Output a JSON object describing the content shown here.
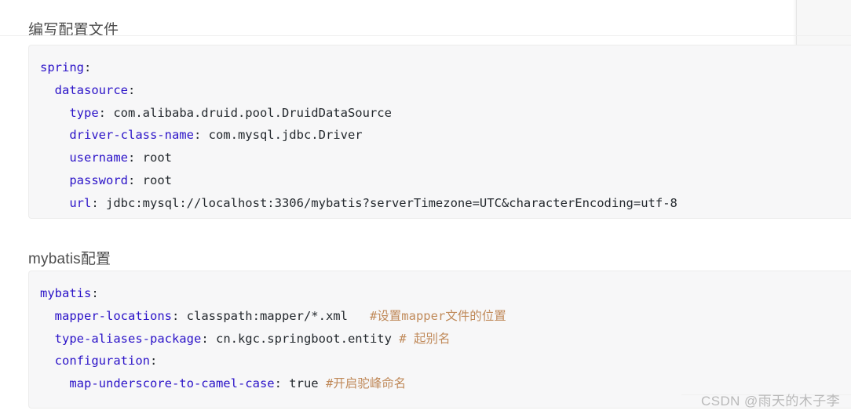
{
  "document": {
    "sections": [
      {
        "heading": "编写配置文件",
        "code_lines": [
          [
            {
              "t": "key",
              "s": "spring"
            },
            {
              "t": "punct",
              "s": ":"
            }
          ],
          [
            {
              "t": "punct",
              "s": "  "
            },
            {
              "t": "key",
              "s": "datasource"
            },
            {
              "t": "punct",
              "s": ":"
            }
          ],
          [
            {
              "t": "punct",
              "s": "    "
            },
            {
              "t": "key",
              "s": "type"
            },
            {
              "t": "punct",
              "s": ": "
            },
            {
              "t": "val",
              "s": "com.alibaba.druid.pool.DruidDataSource"
            }
          ],
          [
            {
              "t": "punct",
              "s": "    "
            },
            {
              "t": "key",
              "s": "driver-class-name"
            },
            {
              "t": "punct",
              "s": ": "
            },
            {
              "t": "val",
              "s": "com.mysql.jdbc.Driver"
            }
          ],
          [
            {
              "t": "punct",
              "s": "    "
            },
            {
              "t": "key",
              "s": "username"
            },
            {
              "t": "punct",
              "s": ": "
            },
            {
              "t": "val",
              "s": "root"
            }
          ],
          [
            {
              "t": "punct",
              "s": "    "
            },
            {
              "t": "key",
              "s": "password"
            },
            {
              "t": "punct",
              "s": ": "
            },
            {
              "t": "val",
              "s": "root"
            }
          ],
          [
            {
              "t": "punct",
              "s": "    "
            },
            {
              "t": "key",
              "s": "url"
            },
            {
              "t": "punct",
              "s": ": "
            },
            {
              "t": "val",
              "s": "jdbc:mysql://localhost:3306/mybatis?serverTimezone=UTC&characterEncoding=utf-8"
            }
          ]
        ]
      },
      {
        "heading": "mybatis配置",
        "code_lines": [
          [
            {
              "t": "key",
              "s": "mybatis"
            },
            {
              "t": "punct",
              "s": ":"
            }
          ],
          [
            {
              "t": "punct",
              "s": "  "
            },
            {
              "t": "key",
              "s": "mapper-locations"
            },
            {
              "t": "punct",
              "s": ": "
            },
            {
              "t": "val",
              "s": "classpath:mapper/*.xml"
            },
            {
              "t": "punct",
              "s": "   "
            },
            {
              "t": "comment",
              "s": "#设置mapper文件的位置"
            }
          ],
          [
            {
              "t": "punct",
              "s": "  "
            },
            {
              "t": "key",
              "s": "type-aliases-package"
            },
            {
              "t": "punct",
              "s": ": "
            },
            {
              "t": "val",
              "s": "cn.kgc.springboot.entity"
            },
            {
              "t": "punct",
              "s": " "
            },
            {
              "t": "comment",
              "s": "# 起别名"
            }
          ],
          [
            {
              "t": "punct",
              "s": "  "
            },
            {
              "t": "key",
              "s": "configuration"
            },
            {
              "t": "punct",
              "s": ":"
            }
          ],
          [
            {
              "t": "punct",
              "s": "    "
            },
            {
              "t": "key",
              "s": "map-underscore-to-camel-case"
            },
            {
              "t": "punct",
              "s": ": "
            },
            {
              "t": "val",
              "s": "true"
            },
            {
              "t": "punct",
              "s": " "
            },
            {
              "t": "comment",
              "s": "#开启驼峰命名"
            }
          ]
        ]
      }
    ]
  },
  "watermark": {
    "text": "CSDN @雨天的木子李"
  },
  "colors": {
    "code_background": "#f7f7f8",
    "code_border": "#ececec",
    "key_token": "#2b13c8",
    "value_token": "#24292e",
    "comment_token": "#c08a5a",
    "heading_text": "#4d4d4d",
    "watermark_text": "#b9b9b9"
  }
}
